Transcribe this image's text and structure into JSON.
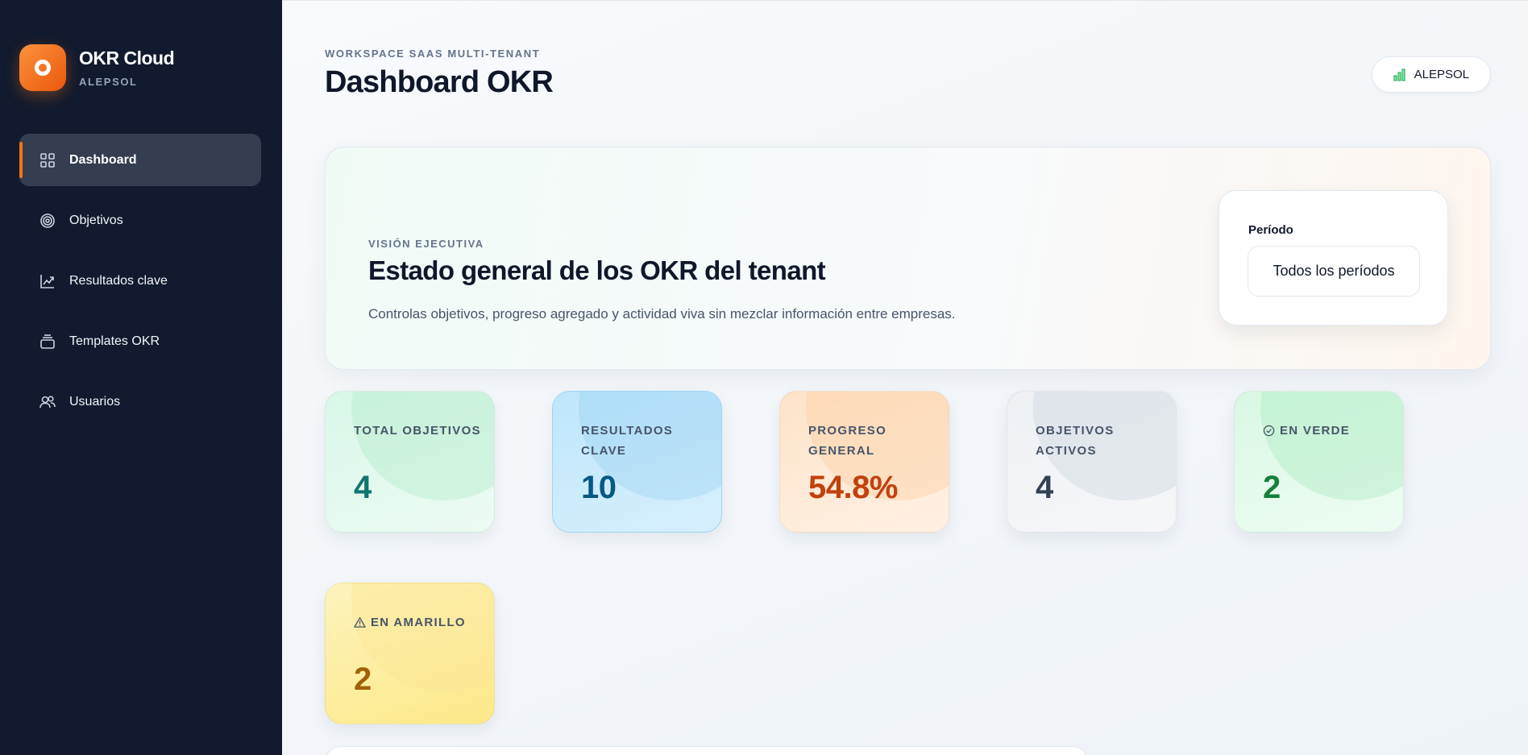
{
  "brand": {
    "name": "OKR Cloud",
    "tenant": "ALEPSOL"
  },
  "sidebar": {
    "items": [
      {
        "label": "Dashboard",
        "icon": "grid-icon",
        "active": true
      },
      {
        "label": "Objetivos",
        "icon": "target-icon",
        "active": false
      },
      {
        "label": "Resultados clave",
        "icon": "trend-chart-icon",
        "active": false
      },
      {
        "label": "Templates OKR",
        "icon": "layers-icon",
        "active": false
      },
      {
        "label": "Usuarios",
        "icon": "users-icon",
        "active": false
      }
    ]
  },
  "header": {
    "eyebrow": "WORKSPACE SAAS MULTI-TENANT",
    "title": "Dashboard OKR",
    "tenant_badge": "ALEPSOL"
  },
  "hero": {
    "eyebrow": "VISIÓN EJECUTIVA",
    "title": "Estado general de los OKR del tenant",
    "description": "Controlas objetivos, progreso agregado y actividad viva sin mezclar información entre empresas.",
    "period": {
      "label": "Período",
      "selected": "Todos los períodos"
    }
  },
  "stats": [
    {
      "label": "TOTAL OBJETIVOS",
      "value": "4",
      "color": "#0f766e"
    },
    {
      "label": "RESULTADOS CLAVE",
      "value": "10",
      "color": "#075985"
    },
    {
      "label": "PROGRESO GENERAL",
      "value": "54.8%",
      "color": "#c2410c"
    },
    {
      "label": "OBJETIVOS ACTIVOS",
      "value": "4",
      "color": "#334155"
    },
    {
      "label": "EN VERDE",
      "value": "2",
      "color": "#15803d",
      "icon": "check-circle-icon"
    },
    {
      "label": "EN AMARILLO",
      "value": "2",
      "color": "#a16207",
      "icon": "warning-icon"
    }
  ],
  "colors": {
    "accent": "#f97316",
    "sidebar_bg": "#111a2e"
  }
}
